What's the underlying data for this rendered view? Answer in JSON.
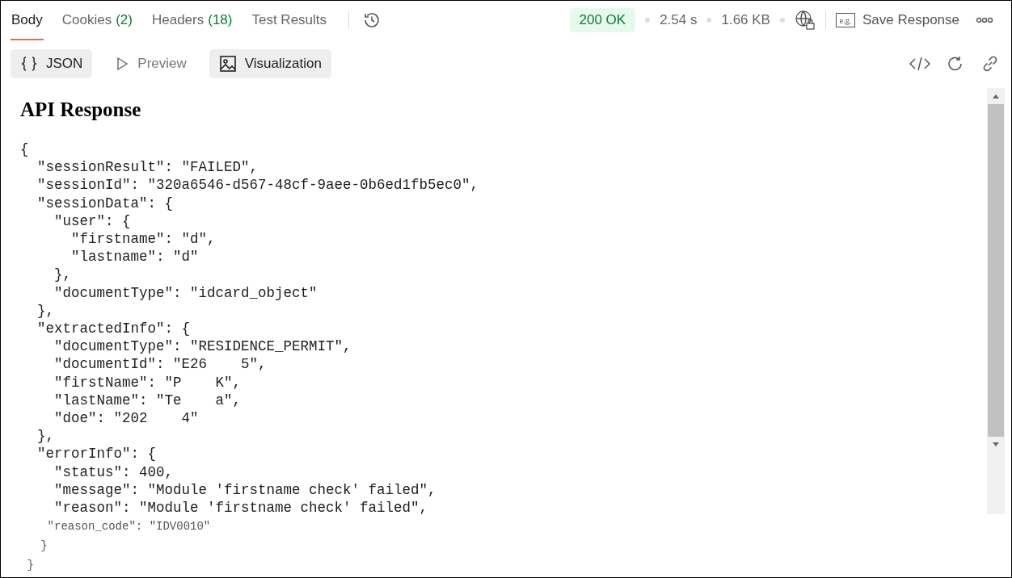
{
  "tabs": [
    {
      "label": "Body",
      "selected": true
    },
    {
      "label": "Cookies",
      "count": "(2)",
      "selected": false
    },
    {
      "label": "Headers",
      "count": "(18)",
      "selected": false
    },
    {
      "label": "Test Results",
      "selected": false
    }
  ],
  "status": {
    "code": "200 OK",
    "time": "2.54 s",
    "size": "1.66 KB"
  },
  "save_response": {
    "icon_text": "e.g.",
    "label": "Save Response"
  },
  "views": [
    {
      "label": "JSON",
      "kind": "braces",
      "selected": true
    },
    {
      "label": "Preview",
      "kind": "play",
      "selected": false
    },
    {
      "label": "Visualization",
      "kind": "image",
      "selected": true
    }
  ],
  "heading": "API Response",
  "code_lines": [
    {
      "text": "{",
      "kind": "normal"
    },
    {
      "text": "  \"sessionResult\": \"FAILED\",",
      "kind": "normal"
    },
    {
      "text": "  \"sessionId\": \"320a6546-d567-48cf-9aee-0b6ed1fb5ec0\",",
      "kind": "normal"
    },
    {
      "text": "  \"sessionData\": {",
      "kind": "normal"
    },
    {
      "text": "    \"user\": {",
      "kind": "normal"
    },
    {
      "text": "      \"firstname\": \"d\",",
      "kind": "normal"
    },
    {
      "text": "      \"lastname\": \"d\"",
      "kind": "normal"
    },
    {
      "text": "    },",
      "kind": "normal"
    },
    {
      "text": "    \"documentType\": \"idcard_object\"",
      "kind": "normal"
    },
    {
      "text": "  },",
      "kind": "normal"
    },
    {
      "text": "  \"extractedInfo\": {",
      "kind": "normal"
    },
    {
      "text": "    \"documentType\": \"RESIDENCE_PERMIT\",",
      "kind": "normal"
    },
    {
      "text": "    \"documentId\": \"E26    5\",",
      "kind": "normal"
    },
    {
      "text": "    \"firstName\": \"P    K\",",
      "kind": "normal"
    },
    {
      "text": "    \"lastName\": \"Te    a\",",
      "kind": "normal"
    },
    {
      "text": "    \"doe\": \"202    4\"",
      "kind": "normal"
    },
    {
      "text": "  },",
      "kind": "normal"
    },
    {
      "text": "  \"errorInfo\": {",
      "kind": "normal"
    },
    {
      "text": "    \"status\": 400,",
      "kind": "normal"
    },
    {
      "text": "    \"message\": \"Module 'firstname check' failed\",",
      "kind": "normal"
    },
    {
      "text": "    \"reason\": \"Module 'firstname check' failed\",",
      "kind": "normal"
    },
    {
      "text": "    \"reason_code\": \"IDV0010\"",
      "kind": "faded"
    },
    {
      "text": "   }",
      "kind": "faded"
    },
    {
      "text": " }",
      "kind": "faded"
    }
  ]
}
